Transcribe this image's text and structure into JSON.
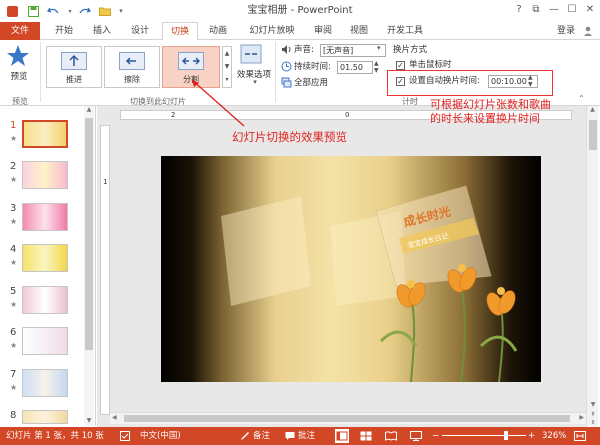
{
  "window": {
    "title": "宝宝相册 - PowerPoint",
    "help": "?",
    "restore": "⧉",
    "minimize": "—",
    "maximize": "☐",
    "close": "✕"
  },
  "quick_access": {
    "save_icon": "save-icon",
    "undo_icon": "undo-icon",
    "redo_icon": "redo-icon",
    "open_icon": "folder-icon",
    "customize_icon": "chevron-down-icon"
  },
  "tabs": [
    "文件",
    "开始",
    "插入",
    "设计",
    "切换",
    "动画",
    "幻灯片放映",
    "审阅",
    "视图",
    "开发工具"
  ],
  "active_tab": "切换",
  "login": "登录",
  "ribbon": {
    "preview_label": "预览",
    "preview_group": "预览",
    "transitions": [
      "推进",
      "擦除",
      "分割"
    ],
    "transitions_group": "切换到此幻灯片",
    "effect_options": "效果选项",
    "sound_label": "声音:",
    "sound_value": "[无声音]",
    "duration_label": "持续时间:",
    "duration_value": "01.50",
    "apply_all": "全部应用",
    "advance_title": "换片方式",
    "on_click": "单击鼠标时",
    "after_time": "设置自动换片时间:",
    "after_value": "00:10.00",
    "timing_group": "计时"
  },
  "ruler": {
    "h_left": "2",
    "h_mid": "0",
    "v_top": "1"
  },
  "slides": [
    {
      "num": "1",
      "star": "★"
    },
    {
      "num": "2",
      "star": "★"
    },
    {
      "num": "3",
      "star": "★"
    },
    {
      "num": "4",
      "star": "★"
    },
    {
      "num": "5",
      "star": "★"
    },
    {
      "num": "6",
      "star": "★"
    },
    {
      "num": "7",
      "star": "★"
    },
    {
      "num": "8",
      "star": "★"
    }
  ],
  "slide_content": {
    "title_art": "成长时光",
    "subtitle": "宝宝成长日记"
  },
  "annotations": {
    "effect_preview": "幻灯片切换的效果预览",
    "timing_note": "可根据幻灯片张数和歌曲的时长来设置换片时间"
  },
  "status": {
    "slide_info": "幻灯片 第 1 张，共 10 张",
    "language": "中文(中国)",
    "notes": "备注",
    "comments": "批注",
    "zoom": "326%",
    "zoom_level": 0.76
  },
  "colors": {
    "accent": "#d24726",
    "annotation": "#e02020"
  }
}
